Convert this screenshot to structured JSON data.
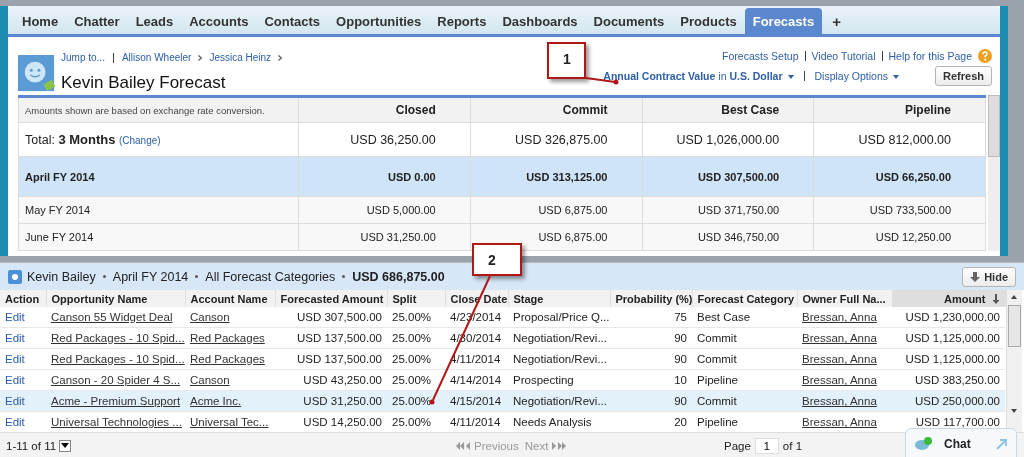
{
  "nav": {
    "tabs": [
      {
        "label": "Home",
        "selected": false
      },
      {
        "label": "Chatter",
        "selected": false
      },
      {
        "label": "Leads",
        "selected": false
      },
      {
        "label": "Accounts",
        "selected": false
      },
      {
        "label": "Contacts",
        "selected": false
      },
      {
        "label": "Opportunities",
        "selected": false
      },
      {
        "label": "Reports",
        "selected": false
      },
      {
        "label": "Dashboards",
        "selected": false
      },
      {
        "label": "Documents",
        "selected": false
      },
      {
        "label": "Products",
        "selected": false
      },
      {
        "label": "Forecasts",
        "selected": true
      }
    ],
    "add_tab": "+"
  },
  "header": {
    "jump_to": "Jump to...",
    "breadcrumbs": [
      "Allison Wheeler",
      "Jessica Heinz"
    ],
    "title": "Kevin Bailey Forecast",
    "top_links": [
      "Forecasts Setup",
      "Video Tutorial",
      "Help for this Page"
    ],
    "measure": {
      "label": "Annual Contract Value",
      "in": "in",
      "currency": "U.S. Dollar"
    },
    "display_options": "Display Options",
    "refresh": "Refresh"
  },
  "summary": {
    "note": "Amounts shown are based on exchange rate conversion.",
    "columns": [
      "Closed",
      "Commit",
      "Best Case",
      "Pipeline"
    ],
    "total": {
      "label": "Total:",
      "period": "3 Months",
      "change": "(Change)",
      "values": [
        "USD 36,250.00",
        "USD 326,875.00",
        "USD 1,026,000.00",
        "USD 812,000.00"
      ]
    },
    "rows": [
      {
        "label": "April FY 2014",
        "selected": true,
        "values": [
          "USD 0.00",
          "USD 313,125.00",
          "USD 307,500.00",
          "USD 66,250.00"
        ]
      },
      {
        "label": "May FY 2014",
        "selected": false,
        "values": [
          "USD 5,000.00",
          "USD 6,875.00",
          "USD 371,750.00",
          "USD 733,500.00"
        ]
      },
      {
        "label": "June FY 2014",
        "selected": false,
        "values": [
          "USD 31,250.00",
          "USD 6,875.00",
          "USD 346,750.00",
          "USD 12,250.00"
        ]
      }
    ]
  },
  "detail": {
    "title_parts": [
      "Kevin Bailey",
      "April FY 2014",
      "All Forecast Categories"
    ],
    "total": "USD 686,875.00",
    "hide": "Hide",
    "columns": [
      {
        "label": "Action",
        "sorted": false
      },
      {
        "label": "Opportunity Name",
        "sorted": false
      },
      {
        "label": "Account Name",
        "sorted": false
      },
      {
        "label": "Forecasted Amount",
        "sorted": false
      },
      {
        "label": "Split",
        "sorted": false
      },
      {
        "label": "Close Date",
        "sorted": false
      },
      {
        "label": "Stage",
        "sorted": false
      },
      {
        "label": "Probability (%)",
        "sorted": false
      },
      {
        "label": "Forecast Category",
        "sorted": false
      },
      {
        "label": "Owner Full Na...",
        "sorted": false
      },
      {
        "label": "Amount",
        "sorted": true
      }
    ],
    "rows": [
      {
        "selected": false,
        "cells": [
          "Edit",
          "Canson 55 Widget Deal",
          "Canson",
          "USD 307,500.00",
          "25.00%",
          "4/23/2014",
          "Proposal/Price Q...",
          "75",
          "Best Case",
          "Bressan, Anna",
          "USD 1,230,000.00"
        ]
      },
      {
        "selected": false,
        "cells": [
          "Edit",
          "Red Packages - 10 Spid...",
          "Red Packages",
          "USD 137,500.00",
          "25.00%",
          "4/30/2014",
          "Negotiation/Revi...",
          "90",
          "Commit",
          "Bressan, Anna",
          "USD 1,125,000.00"
        ]
      },
      {
        "selected": false,
        "cells": [
          "Edit",
          "Red Packages - 10 Spid...",
          "Red Packages",
          "USD 137,500.00",
          "25.00%",
          "4/11/2014",
          "Negotiation/Revi...",
          "90",
          "Commit",
          "Bressan, Anna",
          "USD 1,125,000.00"
        ]
      },
      {
        "selected": false,
        "cells": [
          "Edit",
          "Canson - 20 Spider 4 S...",
          "Canson",
          "USD 43,250.00",
          "25.00%",
          "4/14/2014",
          "Prospecting",
          "10",
          "Pipeline",
          "Bressan, Anna",
          "USD 383,250.00"
        ]
      },
      {
        "selected": true,
        "cells": [
          "Edit",
          "Acme - Premium Support",
          "Acme Inc.",
          "USD 31,250.00",
          "25.00%",
          "4/15/2014",
          "Negotiation/Revi...",
          "90",
          "Commit",
          "Bressan, Anna",
          "USD 250,000.00"
        ]
      },
      {
        "selected": false,
        "cells": [
          "Edit",
          "Universal Technologies ...",
          "Universal Tec...",
          "USD 14,250.00",
          "25.00%",
          "4/11/2014",
          "Needs Analysis",
          "20",
          "Pipeline",
          "Bressan, Anna",
          "USD 117,700.00"
        ]
      }
    ],
    "footer": {
      "range": "1-11 of 11",
      "previous": "Previous",
      "next": "Next",
      "page_label": "Page",
      "page": "1",
      "page_of": "of 1"
    }
  },
  "chat": "Chat",
  "callouts": [
    "1",
    "2"
  ]
}
